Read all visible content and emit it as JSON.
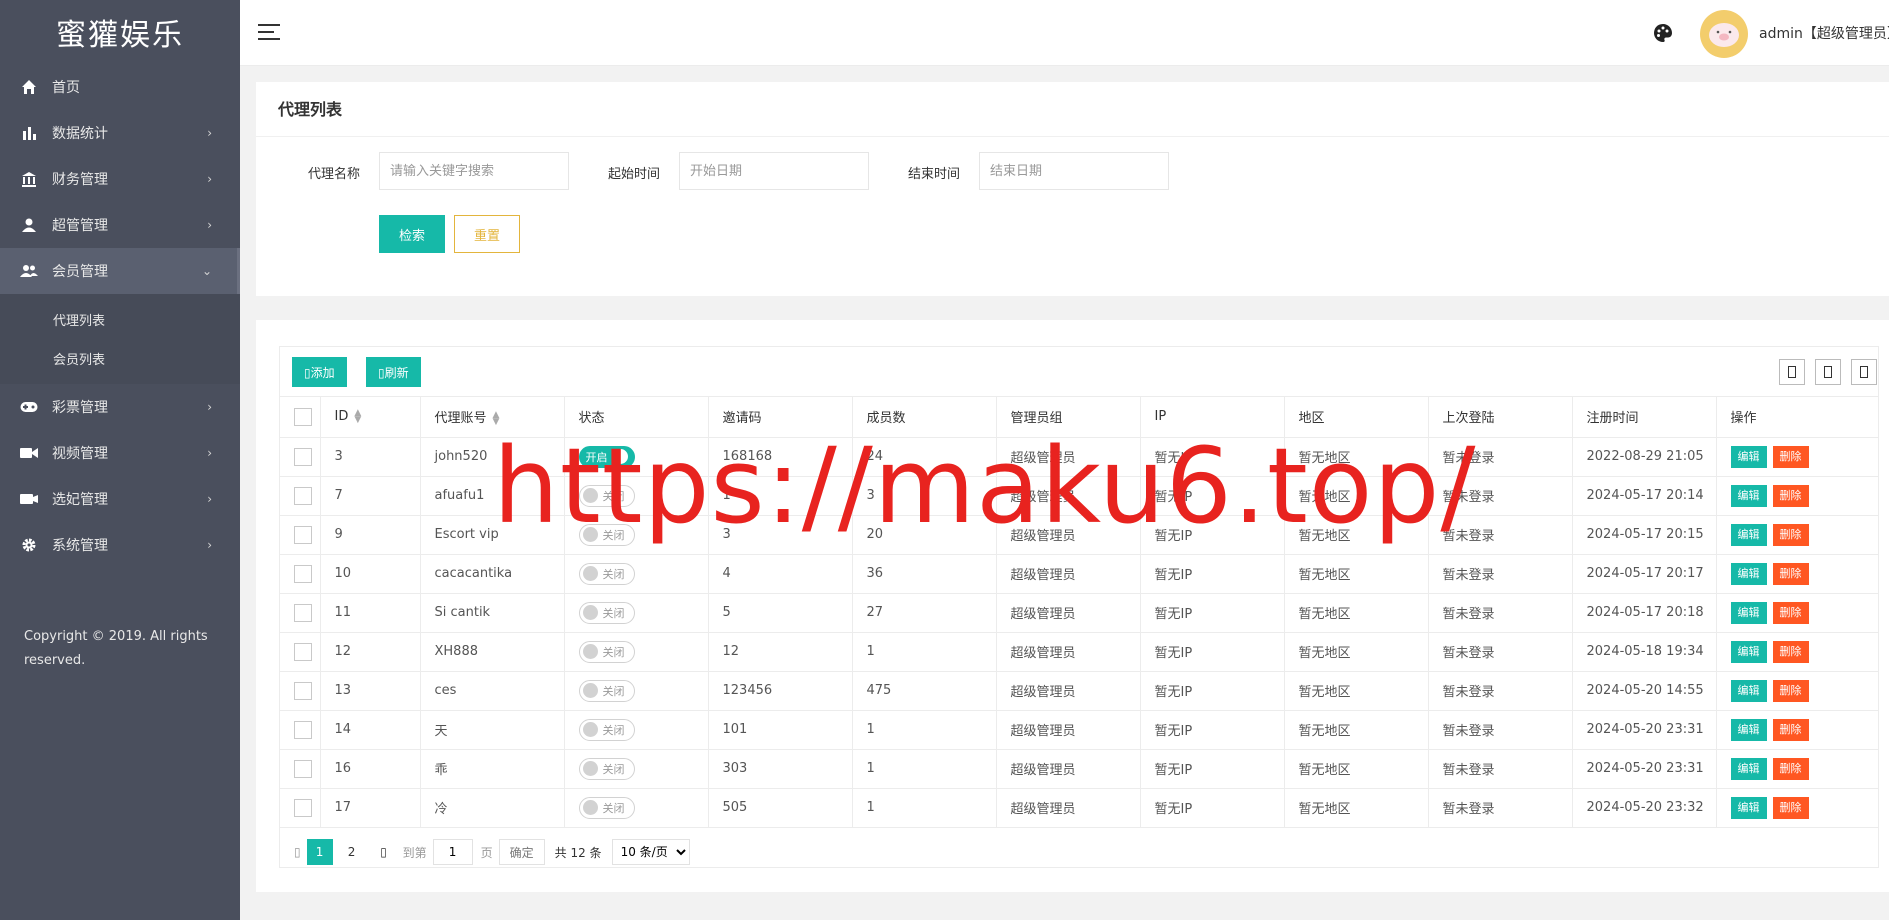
{
  "brand": "蜜獾娱乐",
  "sidebar": {
    "items": [
      {
        "label": "首页",
        "icon": "home-icon",
        "chevron": ""
      },
      {
        "label": "数据统计",
        "icon": "bar-chart-icon",
        "chevron": "›"
      },
      {
        "label": "财务管理",
        "icon": "bank-icon",
        "chevron": "›"
      },
      {
        "label": "超管管理",
        "icon": "user-icon",
        "chevron": "›"
      },
      {
        "label": "会员管理",
        "icon": "users-icon",
        "chevron": "⌄"
      },
      {
        "label": "彩票管理",
        "icon": "gamepad-icon",
        "chevron": "›"
      },
      {
        "label": "视频管理",
        "icon": "video-icon",
        "chevron": "›"
      },
      {
        "label": "选妃管理",
        "icon": "camera-icon",
        "chevron": "›"
      },
      {
        "label": "系统管理",
        "icon": "gear-icon",
        "chevron": "›"
      }
    ],
    "submenu": [
      "代理列表",
      "会员列表"
    ],
    "copyright": "Copyright © 2019. All rights reserved."
  },
  "header": {
    "user": "admin【超级管理员】"
  },
  "search": {
    "title": "代理列表",
    "name_label": "代理名称",
    "name_placeholder": "请输入关键字搜索",
    "start_label": "起始时间",
    "start_placeholder": "开始日期",
    "end_label": "结束时间",
    "end_placeholder": "结束日期",
    "search_btn": "检索",
    "reset_btn": "重置"
  },
  "toolbar": {
    "add": "▯添加",
    "refresh": "▯刷新"
  },
  "table": {
    "columns": [
      "ID",
      "代理账号",
      "状态",
      "邀请码",
      "成员数",
      "管理员组",
      "IP",
      "地区",
      "上次登陆",
      "注册时间",
      "操作"
    ],
    "edit_label": "编辑",
    "delete_label": "删除",
    "on_label": "开启",
    "off_label": "关闭",
    "rows": [
      {
        "id": "3",
        "account": "john520",
        "on": true,
        "code": "168168",
        "members": "24",
        "group": "超级管理员",
        "ip": "暂无IP",
        "region": "暂无地区",
        "last": "暂未登录",
        "reg": "2022-08-29 21:05"
      },
      {
        "id": "7",
        "account": "afuafu1",
        "on": false,
        "code": "1",
        "members": "3",
        "group": "超级管理员",
        "ip": "暂无IP",
        "region": "暂无地区",
        "last": "暂未登录",
        "reg": "2024-05-17 20:14"
      },
      {
        "id": "9",
        "account": "Escort vip",
        "on": false,
        "code": "3",
        "members": "20",
        "group": "超级管理员",
        "ip": "暂无IP",
        "region": "暂无地区",
        "last": "暂未登录",
        "reg": "2024-05-17 20:15"
      },
      {
        "id": "10",
        "account": "cacacantika",
        "on": false,
        "code": "4",
        "members": "36",
        "group": "超级管理员",
        "ip": "暂无IP",
        "region": "暂无地区",
        "last": "暂未登录",
        "reg": "2024-05-17 20:17"
      },
      {
        "id": "11",
        "account": "Si cantik",
        "on": false,
        "code": "5",
        "members": "27",
        "group": "超级管理员",
        "ip": "暂无IP",
        "region": "暂无地区",
        "last": "暂未登录",
        "reg": "2024-05-17 20:18"
      },
      {
        "id": "12",
        "account": "XH888",
        "on": false,
        "code": "12",
        "members": "1",
        "group": "超级管理员",
        "ip": "暂无IP",
        "region": "暂无地区",
        "last": "暂未登录",
        "reg": "2024-05-18 19:34"
      },
      {
        "id": "13",
        "account": "ces",
        "on": false,
        "code": "123456",
        "members": "475",
        "group": "超级管理员",
        "ip": "暂无IP",
        "region": "暂无地区",
        "last": "暂未登录",
        "reg": "2024-05-20 14:55"
      },
      {
        "id": "14",
        "account": "天",
        "on": false,
        "code": "101",
        "members": "1",
        "group": "超级管理员",
        "ip": "暂无IP",
        "region": "暂无地区",
        "last": "暂未登录",
        "reg": "2024-05-20 23:31"
      },
      {
        "id": "16",
        "account": "乖",
        "on": false,
        "code": "303",
        "members": "1",
        "group": "超级管理员",
        "ip": "暂无IP",
        "region": "暂无地区",
        "last": "暂未登录",
        "reg": "2024-05-20 23:31"
      },
      {
        "id": "17",
        "account": "冷",
        "on": false,
        "code": "505",
        "members": "1",
        "group": "超级管理员",
        "ip": "暂无IP",
        "region": "暂无地区",
        "last": "暂未登录",
        "reg": "2024-05-20 23:32"
      }
    ]
  },
  "pager": {
    "prev": "▯",
    "pages": [
      "1",
      "2"
    ],
    "next": "▯",
    "goto_label": "到第",
    "goto_value": "1",
    "page_suffix": "页",
    "confirm": "确定",
    "total": "共 12 条",
    "page_size": "10 条/页"
  },
  "watermark": "https://maku6.top/",
  "colors": {
    "sidebar": "#4a4f5d",
    "accent": "#16b9a8",
    "danger": "#ff5722",
    "warning": "#e3b53d",
    "watermark": "#e8231f"
  }
}
